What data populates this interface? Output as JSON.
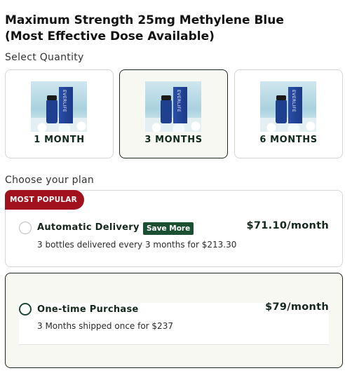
{
  "product": {
    "title_line1": "Maximum Strength 25mg Methylene Blue",
    "title_line2": "(Most Effective Dose Available)"
  },
  "quantity": {
    "label": "Select Quantity",
    "selected": "3 MONTHS",
    "options": [
      {
        "label": "1 MONTH",
        "image_text": "EVERLIFE"
      },
      {
        "label": "3 MONTHS",
        "image_text": "EVERLIFE"
      },
      {
        "label": "6 MONTHS",
        "image_text": "EVERLIFE"
      }
    ]
  },
  "plan": {
    "label": "Choose your plan",
    "selected": "One-time Purchase",
    "options": [
      {
        "ribbon": "MOST POPULAR",
        "name": "Automatic Delivery",
        "badge": "Save More",
        "description": "3 bottles delivered every 3 months for $213.30",
        "price": "$71.10/month"
      },
      {
        "name": "One-time Purchase",
        "description": "3 Months shipped once for $237",
        "price": "$79/month"
      }
    ]
  },
  "colors": {
    "accent_dark_green": "#1b4f32",
    "ribbon_red": "#a1111e",
    "selected_bg": "#f7f8f1",
    "product_blue": "#1f3f8f"
  }
}
